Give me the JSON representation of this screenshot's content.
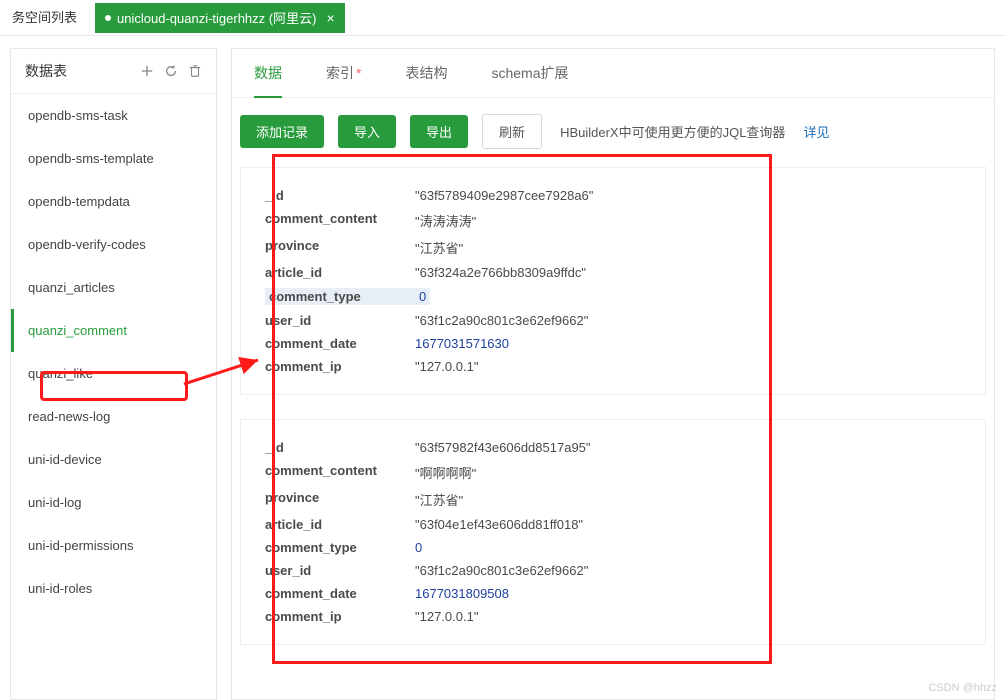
{
  "tabs": {
    "left_label": "务空间列表",
    "active_label": "unicloud-quanzi-tigerhhzz (阿里云)"
  },
  "sidebar": {
    "title": "数据表",
    "items": [
      {
        "label": "opendb-sms-task",
        "active": false
      },
      {
        "label": "opendb-sms-template",
        "active": false
      },
      {
        "label": "opendb-tempdata",
        "active": false
      },
      {
        "label": "opendb-verify-codes",
        "active": false
      },
      {
        "label": "quanzi_articles",
        "active": false
      },
      {
        "label": "quanzi_comment",
        "active": true
      },
      {
        "label": "quanzi_like",
        "active": false
      },
      {
        "label": "read-news-log",
        "active": false
      },
      {
        "label": "uni-id-device",
        "active": false
      },
      {
        "label": "uni-id-log",
        "active": false
      },
      {
        "label": "uni-id-permissions",
        "active": false
      },
      {
        "label": "uni-id-roles",
        "active": false
      }
    ]
  },
  "content_tabs": [
    {
      "label": "数据",
      "asterisk": false,
      "active": true
    },
    {
      "label": "索引",
      "asterisk": true,
      "active": false
    },
    {
      "label": "表结构",
      "asterisk": false,
      "active": false
    },
    {
      "label": "schema扩展",
      "asterisk": false,
      "active": false
    }
  ],
  "toolbar": {
    "add_label": "添加记录",
    "import_label": "导入",
    "export_label": "导出",
    "refresh_label": "刷新",
    "hint_text": "HBuilderX中可使用更方便的JQL查询器",
    "link_label": "详见"
  },
  "records": [
    {
      "fields": [
        {
          "k": "_id",
          "v": "\"63f5789409e2987cee7928a6\"",
          "t": "str"
        },
        {
          "k": "comment_content",
          "v": "\"涛涛涛涛\"",
          "t": "str"
        },
        {
          "k": "province",
          "v": "\"江苏省\"",
          "t": "str"
        },
        {
          "k": "article_id",
          "v": "\"63f324a2e766bb8309a9ffdc\"",
          "t": "str"
        },
        {
          "k": "comment_type",
          "v": "0",
          "t": "num",
          "hl": true
        },
        {
          "k": "user_id",
          "v": "\"63f1c2a90c801c3e62ef9662\"",
          "t": "str"
        },
        {
          "k": "comment_date",
          "v": "1677031571630",
          "t": "num"
        },
        {
          "k": "comment_ip",
          "v": "\"127.0.0.1\"",
          "t": "str"
        }
      ]
    },
    {
      "fields": [
        {
          "k": "_id",
          "v": "\"63f57982f43e606dd8517a95\"",
          "t": "str"
        },
        {
          "k": "comment_content",
          "v": "\"啊啊啊啊\"",
          "t": "str"
        },
        {
          "k": "province",
          "v": "\"江苏省\"",
          "t": "str"
        },
        {
          "k": "article_id",
          "v": "\"63f04e1ef43e606dd81ff018\"",
          "t": "str"
        },
        {
          "k": "comment_type",
          "v": "0",
          "t": "num"
        },
        {
          "k": "user_id",
          "v": "\"63f1c2a90c801c3e62ef9662\"",
          "t": "str"
        },
        {
          "k": "comment_date",
          "v": "1677031809508",
          "t": "num"
        },
        {
          "k": "comment_ip",
          "v": "\"127.0.0.1\"",
          "t": "str"
        }
      ]
    }
  ],
  "watermark": "CSDN @hhzz"
}
